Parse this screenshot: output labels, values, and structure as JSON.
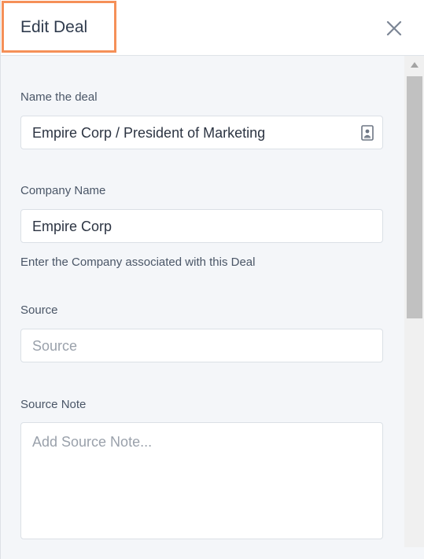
{
  "header": {
    "title": "Edit Deal",
    "close_icon": "close-icon"
  },
  "form": {
    "deal_name": {
      "label": "Name the deal",
      "value": "Empire Corp / President of Marketing",
      "icon": "contact-card-icon"
    },
    "company_name": {
      "label": "Company Name",
      "value": "Empire Corp",
      "helper": "Enter the Company associated with this Deal"
    },
    "source": {
      "label": "Source",
      "placeholder": "Source",
      "value": ""
    },
    "source_note": {
      "label": "Source Note",
      "placeholder": "Add Source Note...",
      "value": ""
    }
  },
  "colors": {
    "highlight": "#f59058",
    "background": "#f4f6f9",
    "text": "#2c3442"
  }
}
